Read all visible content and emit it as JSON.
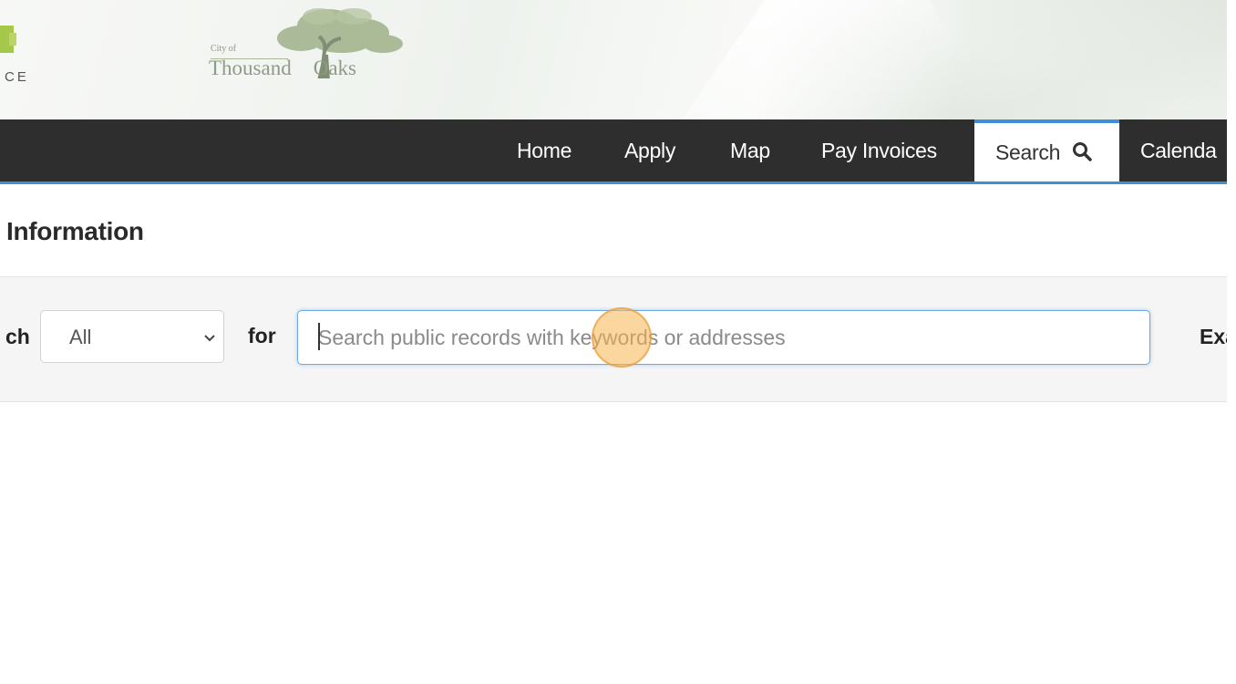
{
  "banner": {
    "left_logo_text": "CE",
    "city_of": "City of",
    "city_name_1": "Thousand",
    "city_name_2": "Oaks"
  },
  "nav": {
    "items": [
      {
        "label": "Home"
      },
      {
        "label": "Apply"
      },
      {
        "label": "Map"
      },
      {
        "label": "Pay Invoices"
      },
      {
        "label": "Search",
        "active": true,
        "icon": "search-icon"
      },
      {
        "label": "Calenda"
      }
    ]
  },
  "page": {
    "heading": "Information"
  },
  "search": {
    "label_prefix": "ch",
    "scope_value": "All",
    "for_label": "for",
    "placeholder": "Search public records with keywords or addresses",
    "trailing_label": "Exa"
  },
  "colors": {
    "nav_bg": "#2e2e2e",
    "accent": "#3f8ed6",
    "logo_green": "#a6c84a"
  }
}
